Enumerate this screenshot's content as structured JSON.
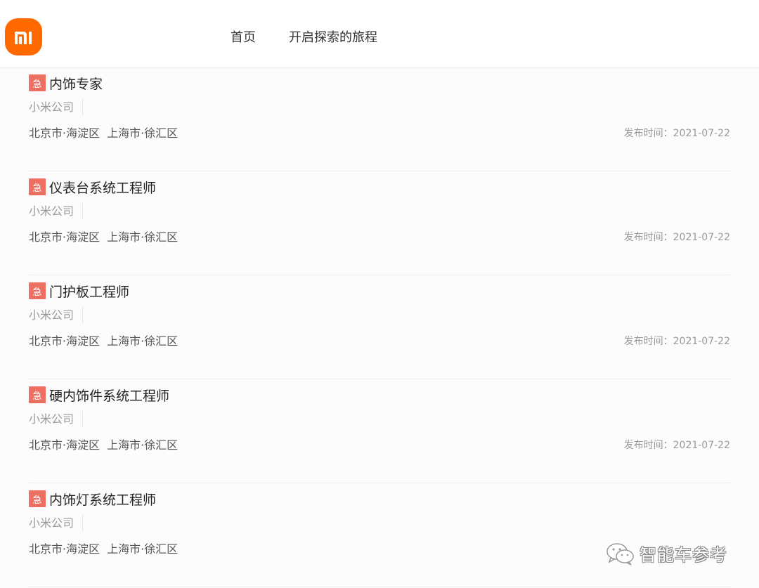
{
  "header": {
    "logo_text": "mi",
    "nav": [
      {
        "label": "首页"
      },
      {
        "label": "开启探索的旅程"
      }
    ]
  },
  "colors": {
    "brand": "#ff6900",
    "urgent_badge": "#ee6e62"
  },
  "jobs": [
    {
      "badge": "急",
      "title": "内饰专家",
      "company": "小米公司",
      "locations": [
        "北京市·海淀区",
        "上海市·徐汇区"
      ],
      "date_label": "发布时间：2021-07-22"
    },
    {
      "badge": "急",
      "title": "仪表台系统工程师",
      "company": "小米公司",
      "locations": [
        "北京市·海淀区",
        "上海市·徐汇区"
      ],
      "date_label": "发布时间：2021-07-22"
    },
    {
      "badge": "急",
      "title": "门护板工程师",
      "company": "小米公司",
      "locations": [
        "北京市·海淀区",
        "上海市·徐汇区"
      ],
      "date_label": "发布时间：2021-07-22"
    },
    {
      "badge": "急",
      "title": "硬内饰件系统工程师",
      "company": "小米公司",
      "locations": [
        "北京市·海淀区",
        "上海市·徐汇区"
      ],
      "date_label": "发布时间：2021-07-22"
    },
    {
      "badge": "急",
      "title": "内饰灯系统工程师",
      "company": "小米公司",
      "locations": [
        "北京市·海淀区",
        "上海市·徐汇区"
      ],
      "date_label": ""
    }
  ],
  "watermark": {
    "icon": "wechat-icon",
    "text": "智能车参考"
  }
}
